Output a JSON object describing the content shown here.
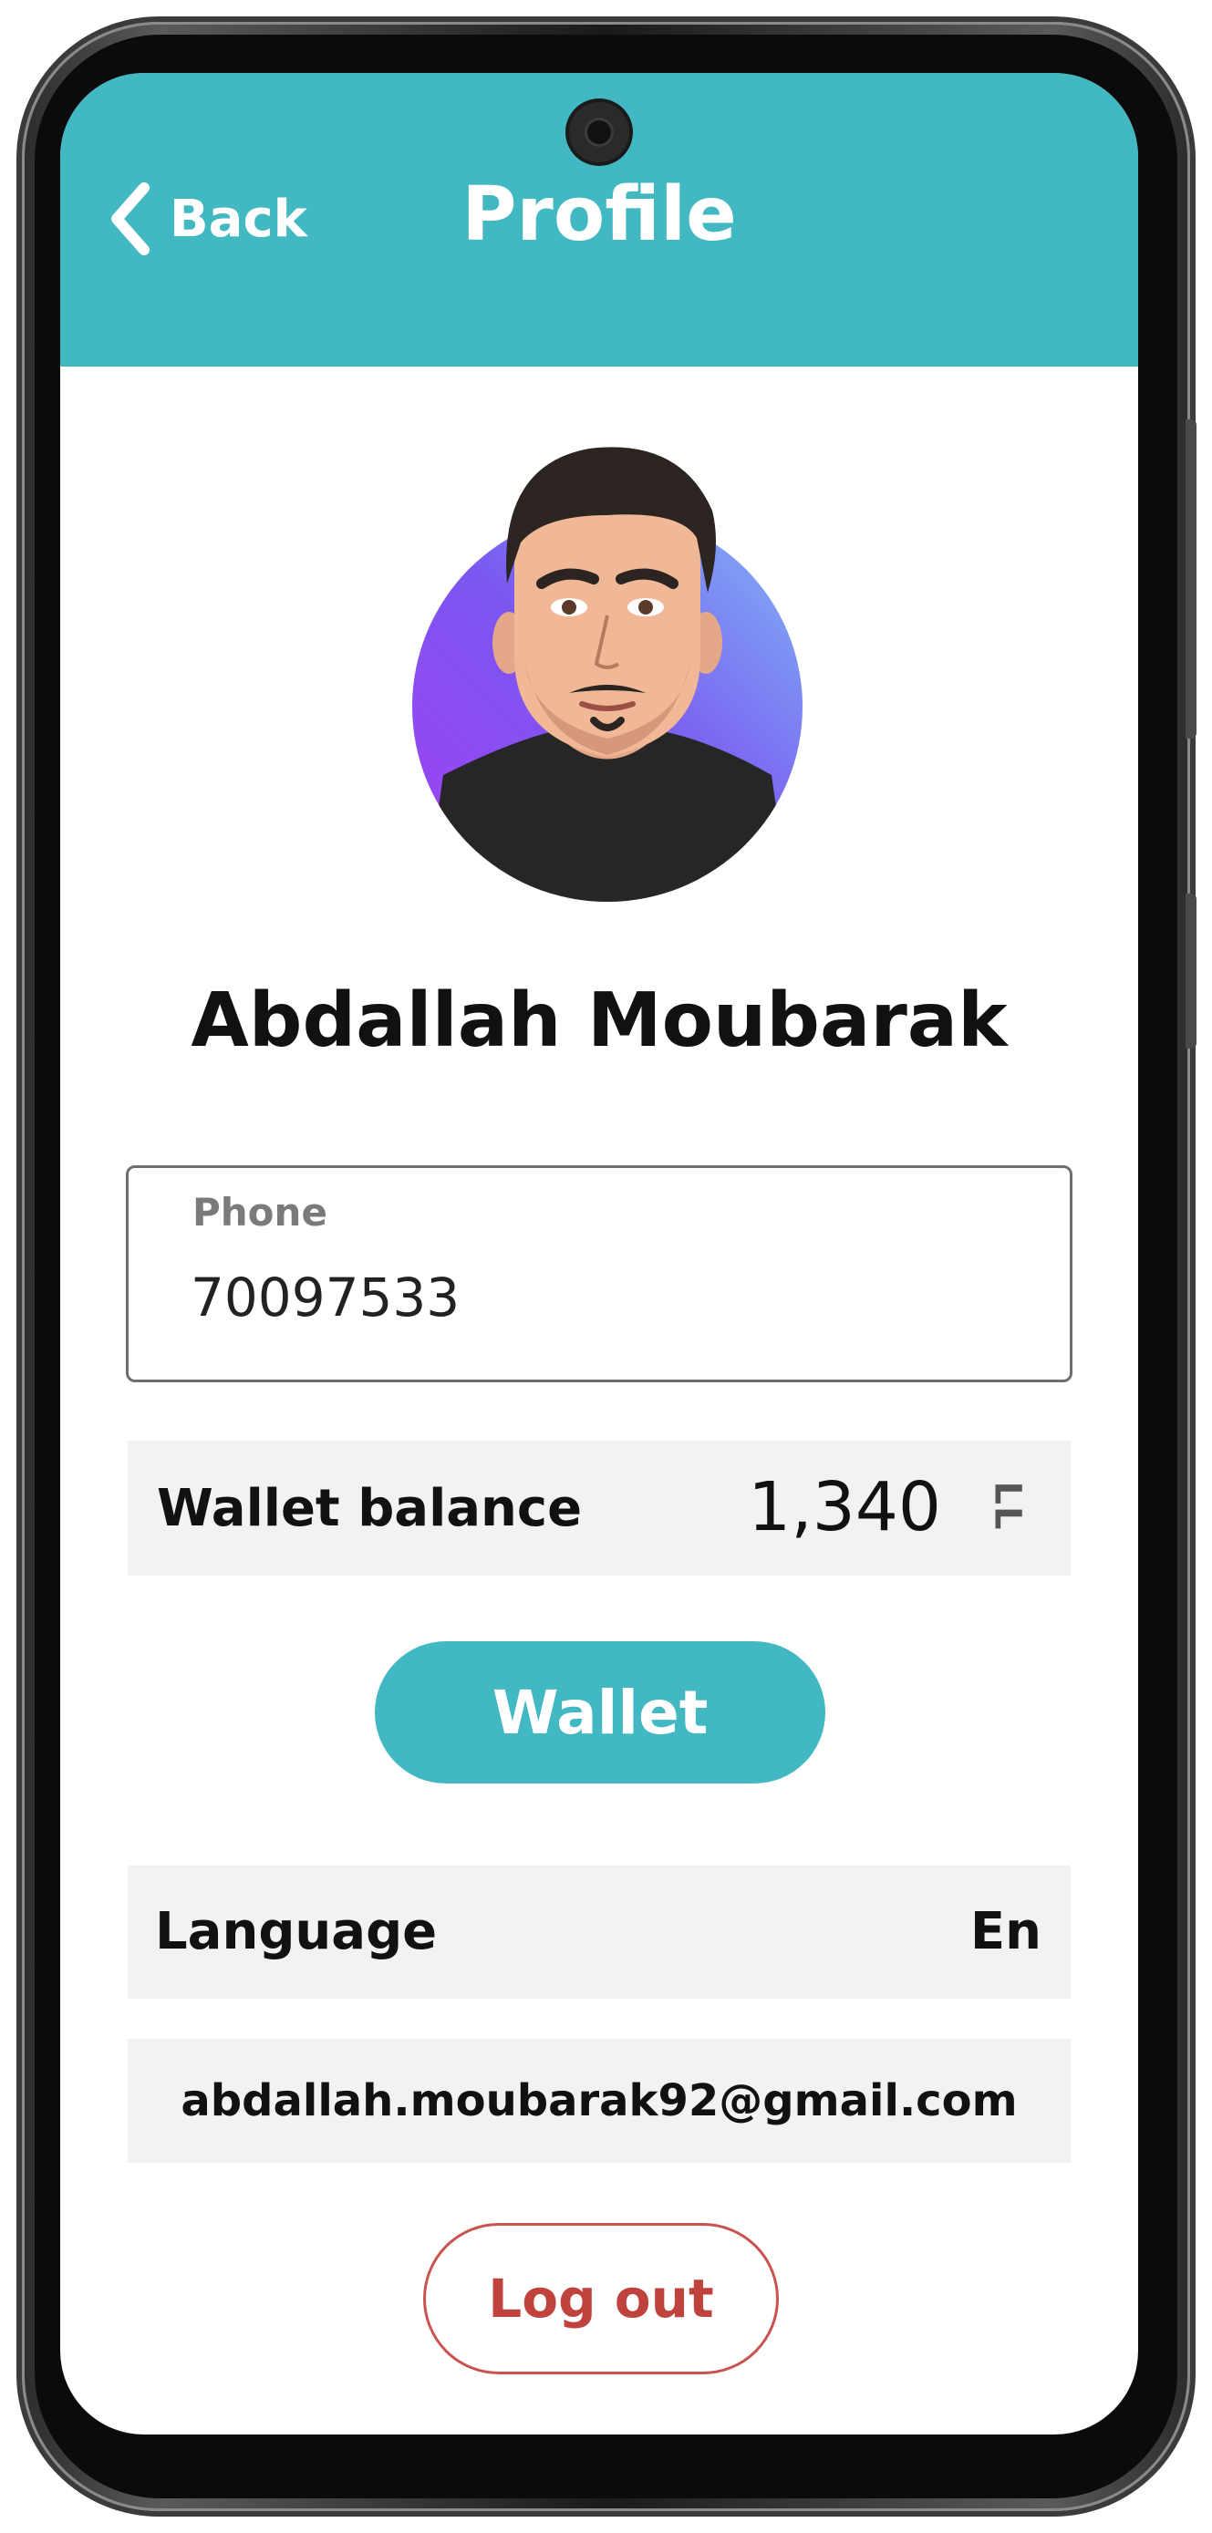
{
  "header": {
    "back_label": "Back",
    "title": "Profile",
    "accent_color": "#41b8c2"
  },
  "profile": {
    "name": "Abdallah Moubarak",
    "avatar": "cartoon-avatar"
  },
  "phone_field": {
    "label": "Phone",
    "value": "70097533"
  },
  "wallet": {
    "label": "Wallet balance",
    "amount": "1,340",
    "currency": "LL",
    "button_label": "Wallet"
  },
  "language": {
    "label": "Language",
    "value": "En"
  },
  "email": {
    "value": "abdallah.moubarak92@gmail.com"
  },
  "logout": {
    "label": "Log out",
    "color": "#c0423d"
  },
  "icons": {
    "back": "chevron-left-icon",
    "currency": "currency-icon"
  }
}
